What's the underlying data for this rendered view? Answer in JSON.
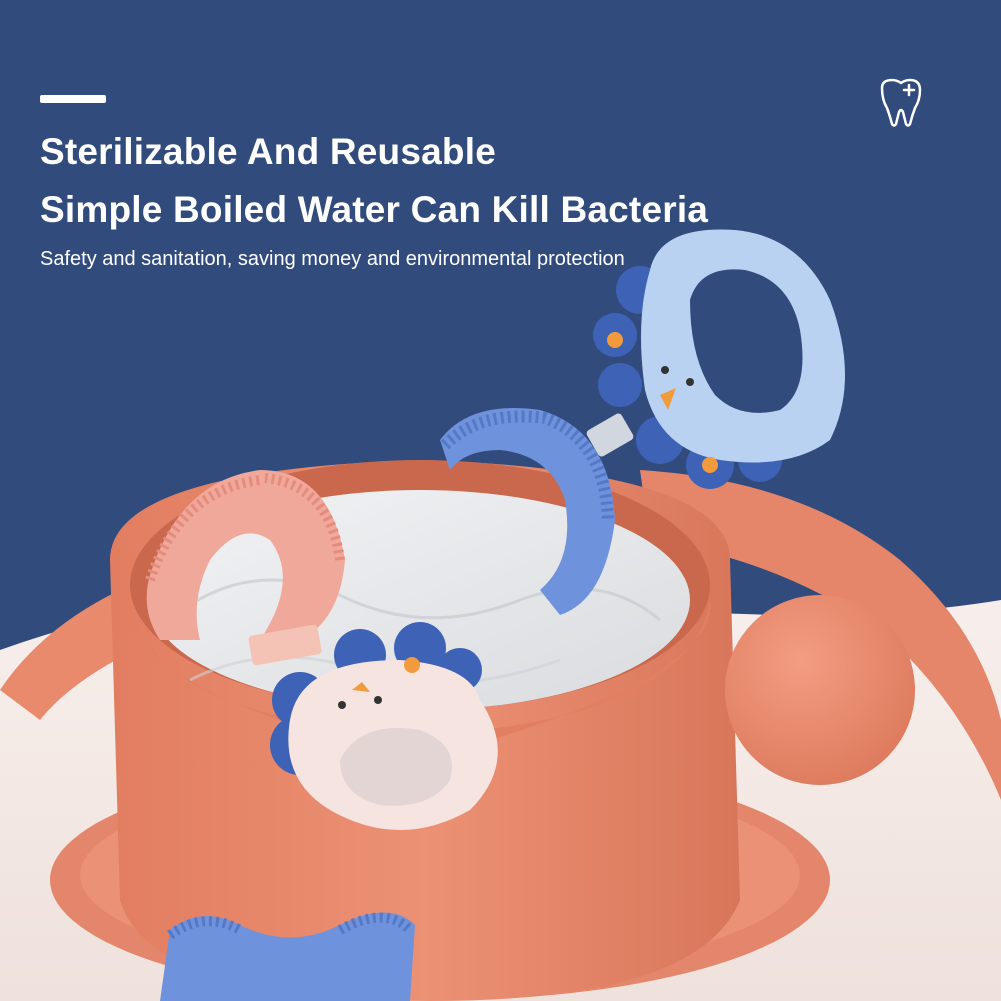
{
  "headline": {
    "line1": "Sterilizable And Reusable",
    "line2": "Simple Boiled Water Can Kill Bacteria"
  },
  "subheadline": "Safety and sanitation, saving money and environmental protection",
  "icons": {
    "badge": "tooth-plus-icon"
  },
  "colors": {
    "background": "#314b7d",
    "bowl": "#e98a6c",
    "bowl_shadow": "#c9684d",
    "water": "#e7e8ea",
    "table": "#f3ebe7",
    "brush_blue": "#6f92dc",
    "brush_pink": "#f0a89b",
    "handle_blue": "#b9d2f2",
    "handle_pink": "#f6e4e0",
    "mane_blue": "#3d62b6",
    "text": "#ffffff"
  }
}
